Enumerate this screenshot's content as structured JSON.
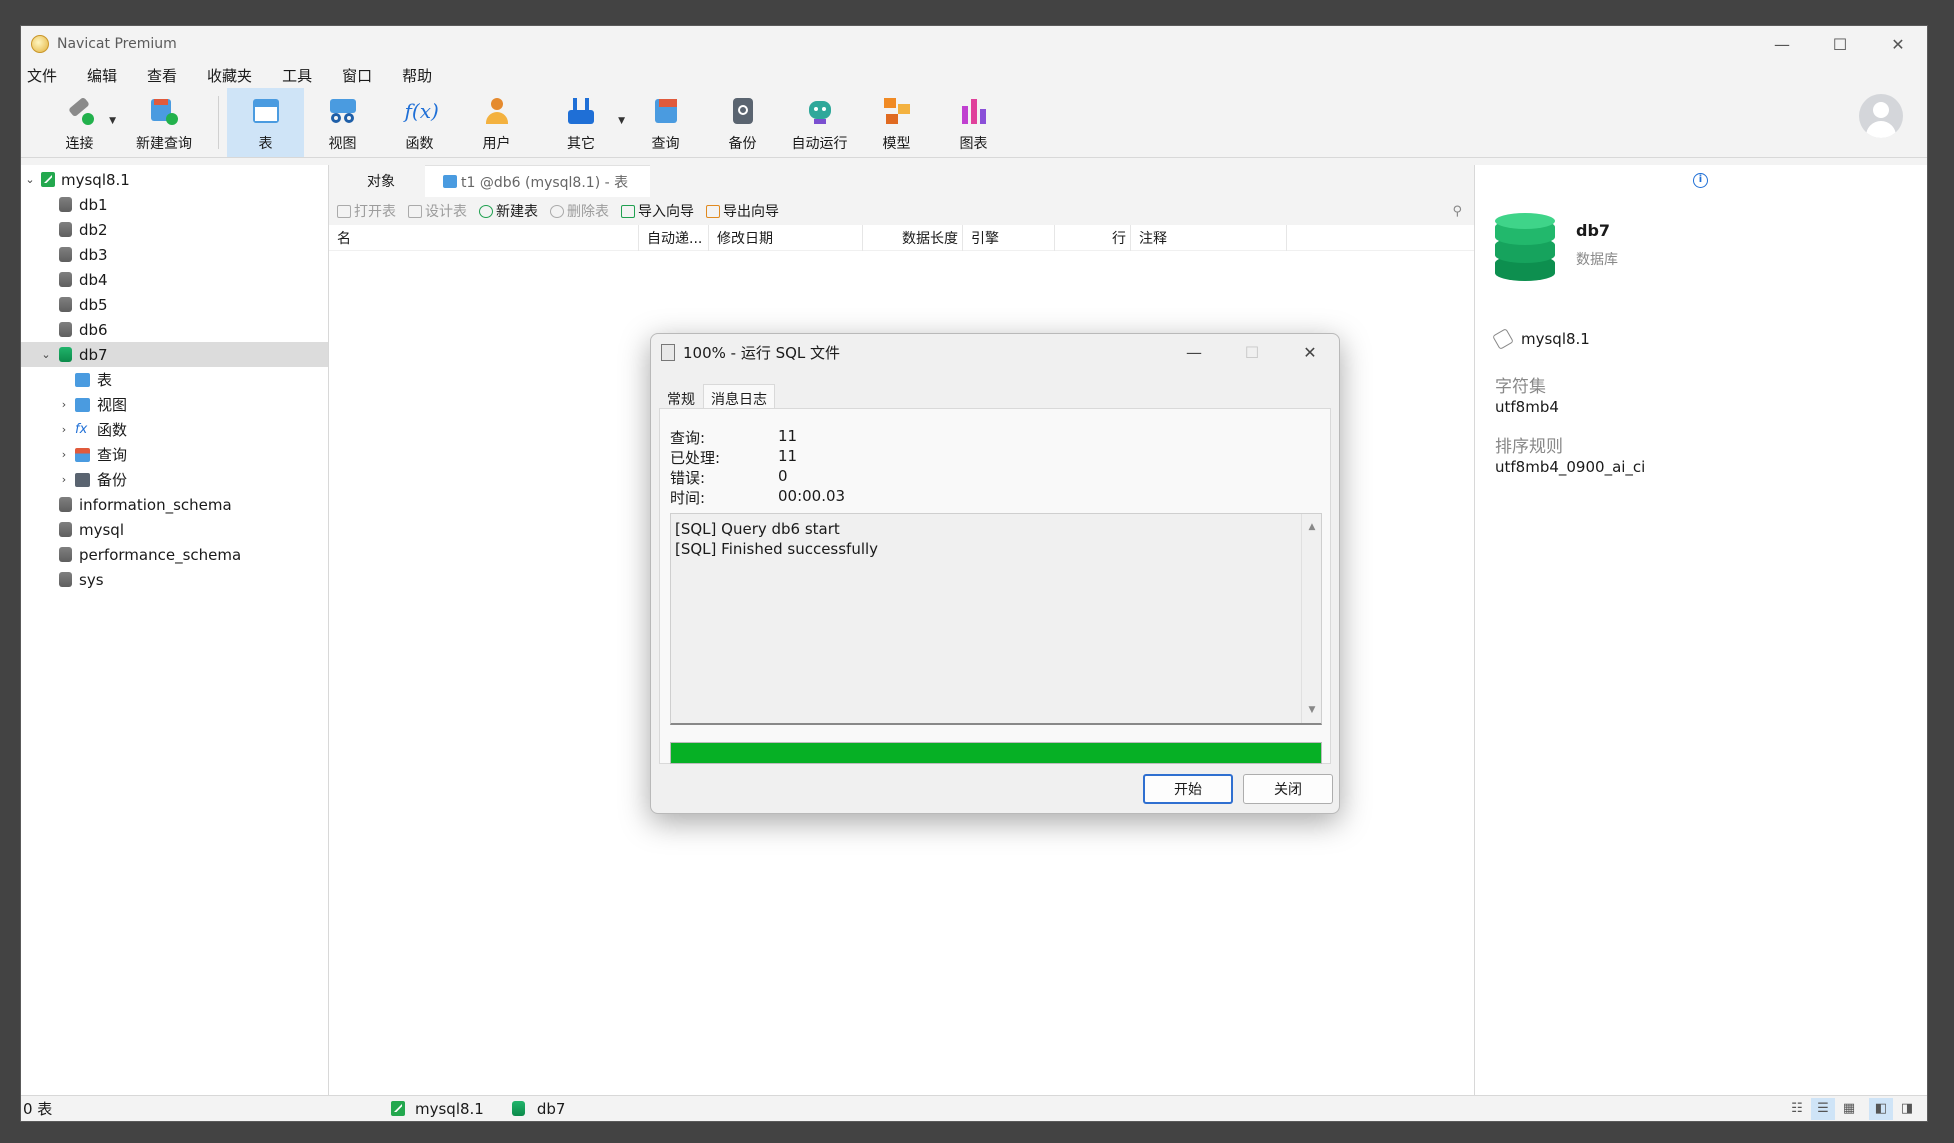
{
  "app": {
    "title": "Navicat Premium"
  },
  "menu": [
    "文件",
    "编辑",
    "查看",
    "收藏夹",
    "工具",
    "窗口",
    "帮助"
  ],
  "toolbar": {
    "connect": "连接",
    "new_query": "新建查询",
    "table": "表",
    "view": "视图",
    "function": "函数",
    "user": "用户",
    "other": "其它",
    "query": "查询",
    "backup": "备份",
    "auto_run": "自动运行",
    "model": "模型",
    "chart": "图表"
  },
  "tree": {
    "connection": "mysql8.1",
    "dbs_before": [
      "db1",
      "db2",
      "db3",
      "db4",
      "db5",
      "db6"
    ],
    "selected_db": "db7",
    "children": [
      "表",
      "视图",
      "函数",
      "查询",
      "备份"
    ],
    "dbs_after": [
      "information_schema",
      "mysql",
      "performance_schema",
      "sys"
    ]
  },
  "tabs": {
    "objects": "对象",
    "t1": "t1 @db6 (mysql8.1) - 表"
  },
  "objbar": {
    "open": "打开表",
    "design": "设计表",
    "new": "新建表",
    "delete": "删除表",
    "import": "导入向导",
    "export": "导出向导"
  },
  "columns": [
    "名",
    "自动递...",
    "修改日期",
    "数据长度",
    "引擎",
    "行",
    "注释"
  ],
  "right_panel": {
    "name": "db7",
    "type": "数据库",
    "connection": "mysql8.1",
    "charset_label": "字符集",
    "charset": "utf8mb4",
    "collation_label": "排序规则",
    "collation": "utf8mb4_0900_ai_ci"
  },
  "status": {
    "count": "0 表",
    "connection": "mysql8.1",
    "db": "db7"
  },
  "dialog": {
    "title": "100% - 运行 SQL 文件",
    "tab_general": "常规",
    "tab_log": "消息日志",
    "stats": [
      {
        "label": "查询:",
        "value": "11"
      },
      {
        "label": "已处理:",
        "value": "11"
      },
      {
        "label": "错误:",
        "value": "0"
      },
      {
        "label": "时间:",
        "value": "00:00.03"
      }
    ],
    "log": [
      "[SQL] Query db6 start",
      "[SQL] Finished successfully"
    ],
    "progress": 1.0,
    "start_button": "开始",
    "close_button": "关闭"
  },
  "colors": {
    "accent": "#1f6fd6",
    "progress": "#06b025",
    "db_green": "#0c8a4a"
  }
}
